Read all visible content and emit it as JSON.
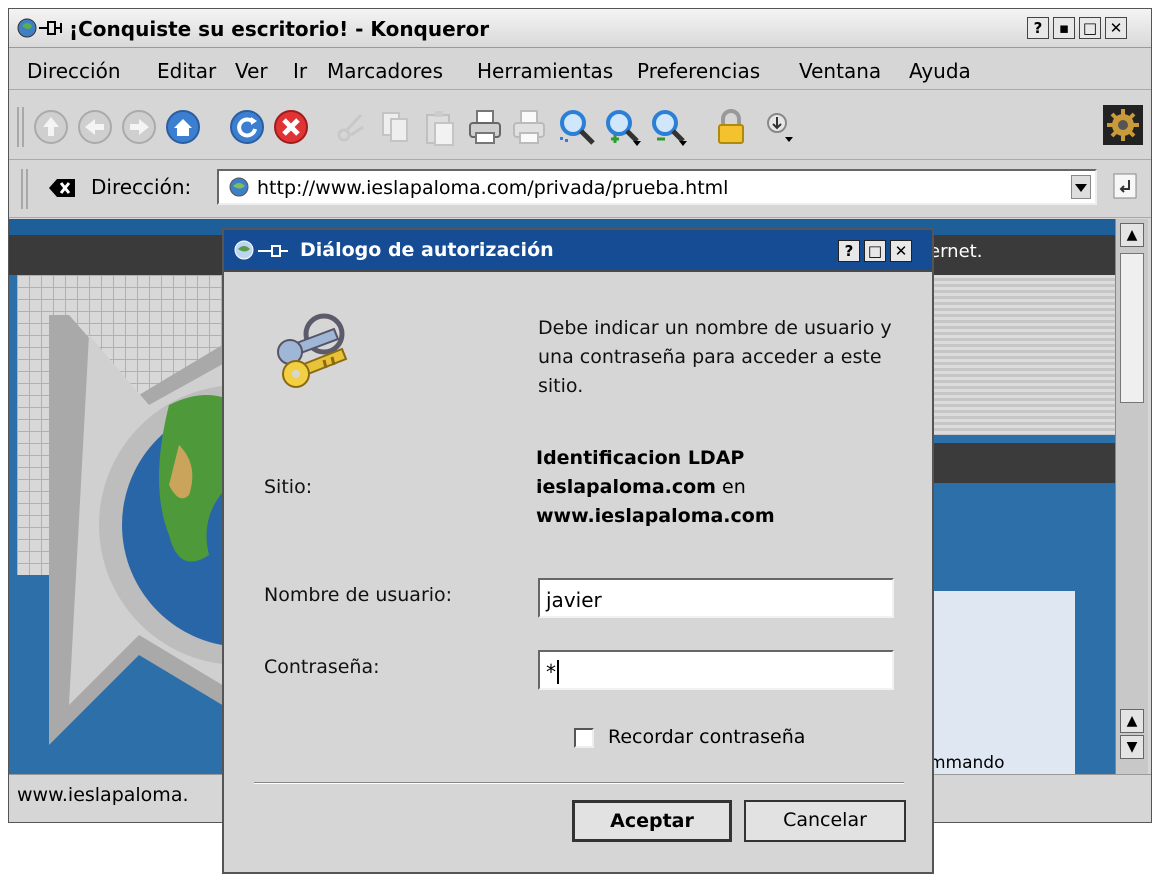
{
  "window": {
    "title": "¡Conquiste su escritorio! - Konqueror",
    "buttons": {
      "help": "?",
      "minimize": "▪",
      "maximize": "□",
      "close": "✕"
    }
  },
  "menubar": {
    "items": [
      "Dirección",
      "Editar",
      "Ver",
      "Ir",
      "Marcadores",
      "Herramientas",
      "Preferencias",
      "Ventana",
      "Ayuda"
    ]
  },
  "toolbar": {
    "icons": [
      "up-icon",
      "back-icon",
      "forward-icon",
      "home-icon",
      "reload-icon",
      "stop-icon",
      "cut-icon",
      "copy-icon",
      "paste-icon",
      "print-icon",
      "print-frame-icon",
      "zoom-in-icon",
      "zoom-out-icon",
      "zoom-icon",
      "security-lock-icon",
      "download-icon",
      "activity-gear-icon"
    ]
  },
  "location": {
    "label": "Dirección:",
    "url": "http://www.ieslapaloma.com/privada/prueba.html"
  },
  "page": {
    "visible_text_right": "ernet.",
    "visible_text_bottom": "mmando"
  },
  "statusbar": {
    "text": "www.ieslapaloma."
  },
  "dialog": {
    "title": "Diálogo de autorización",
    "message": "Debe indicar un nombre de usuario y una contraseña para acceder a este sitio.",
    "site_label": "Sitio:",
    "site_realm": "Identificacion LDAP",
    "site_host": "ieslapaloma.com",
    "site_connector": "en",
    "site_server": "www.ieslapaloma.com",
    "username_label": "Nombre de usuario:",
    "username_value": "javier",
    "password_label": "Contraseña:",
    "password_value": "*",
    "remember_label": "Recordar contraseña",
    "remember_checked": false,
    "ok_label": "Aceptar",
    "cancel_label": "Cancelar"
  },
  "colors": {
    "dialog_titlebar": "#154c94",
    "page_background": "#2d6fa8"
  }
}
